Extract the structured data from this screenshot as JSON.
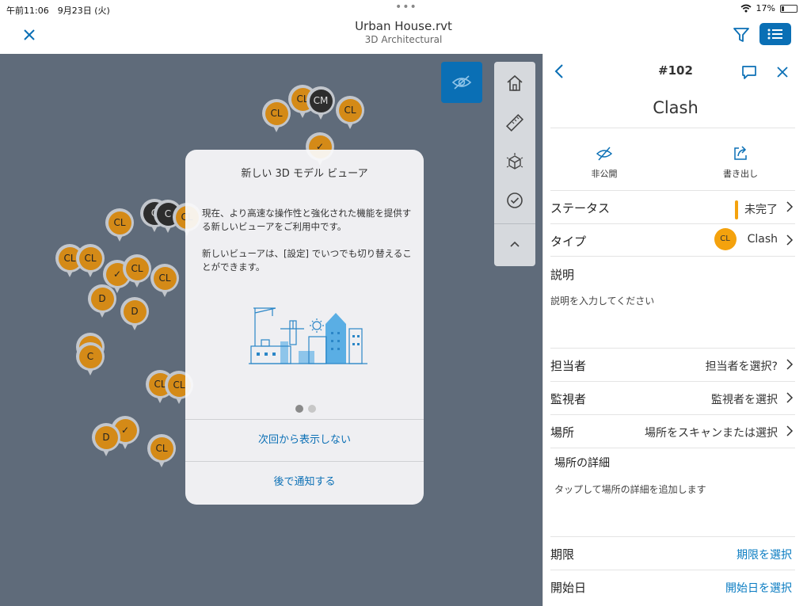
{
  "status_bar": {
    "time": "午前11:06　9月23日 (火)",
    "battery": "17%"
  },
  "header": {
    "title": "Urban House.rvt",
    "subtitle": "3D Architectural"
  },
  "icons": {
    "close": "close-icon",
    "filter": "filter-icon",
    "list": "list-icon",
    "hide_markups": "eye-slash-icon",
    "home": "home-icon",
    "measure": "ruler-icon",
    "explode": "model-explode-icon",
    "checklist": "check-circle-icon",
    "collapse": "chevron-up-icon"
  },
  "colors": {
    "accent": "#0a6fb5",
    "pin_orange": "#d48a17",
    "status_orange": "#f4a20d",
    "viewer_bg": "#5f6b7a"
  },
  "pins": [
    {
      "label": "CL",
      "kind": "orange"
    },
    {
      "label": "CL",
      "kind": "orange"
    },
    {
      "label": "CM",
      "kind": "dark"
    },
    {
      "label": "CL",
      "kind": "orange"
    },
    {
      "label": "✓",
      "kind": "orange"
    },
    {
      "label": "CL",
      "kind": "orange"
    },
    {
      "label": "C",
      "kind": "dark"
    },
    {
      "label": "C",
      "kind": "dark"
    },
    {
      "label": "CL",
      "kind": "orange"
    },
    {
      "label": "CL",
      "kind": "orange"
    },
    {
      "label": "CL",
      "kind": "orange"
    },
    {
      "label": "✓",
      "kind": "orange"
    },
    {
      "label": "CL",
      "kind": "orange"
    },
    {
      "label": "CL",
      "kind": "orange"
    },
    {
      "label": "D",
      "kind": "orange"
    },
    {
      "label": "D",
      "kind": "orange"
    },
    {
      "label": "CL",
      "kind": "orange"
    },
    {
      "label": "C",
      "kind": "orange"
    },
    {
      "label": "CL",
      "kind": "orange"
    },
    {
      "label": "CL",
      "kind": "orange"
    },
    {
      "label": "✓",
      "kind": "orange"
    },
    {
      "label": "D",
      "kind": "orange"
    },
    {
      "label": "CL",
      "kind": "orange"
    }
  ],
  "dialog": {
    "title": "新しい 3D モデル ビューア",
    "body1": "現在、より高速な操作性と強化された機能を提供する新しいビューアをご利用中です。",
    "body2": "新しいビューアは、[設定] でいつでも切り替えることができます。",
    "page_count": 2,
    "active_page": 1,
    "action_primary": "次回から表示しない",
    "action_secondary": "後で通知する"
  },
  "panel": {
    "issue_number": "#102",
    "issue_title": "Clash",
    "actions": [
      {
        "label": "非公開",
        "icon": "eye-slash-icon"
      },
      {
        "label": "書き出し",
        "icon": "export-icon"
      }
    ],
    "fields": {
      "status": {
        "label": "ステータス",
        "value": "未完了"
      },
      "type": {
        "label": "タイプ",
        "badge": "CL",
        "value": "Clash"
      },
      "description": {
        "label": "説明",
        "placeholder": "説明を入力してください"
      },
      "assignee": {
        "label": "担当者",
        "value": "担当者を選択?"
      },
      "watcher": {
        "label": "監視者",
        "value": "監視者を選択"
      },
      "location": {
        "label": "場所",
        "value": "場所をスキャンまたは選択"
      },
      "location_detail": {
        "label": "場所の詳細",
        "placeholder": "タップして場所の詳細を追加します"
      },
      "due_date": {
        "label": "期限",
        "value": "期限を選択"
      },
      "start_date": {
        "label": "開始日",
        "value": "開始日を選択"
      }
    }
  }
}
